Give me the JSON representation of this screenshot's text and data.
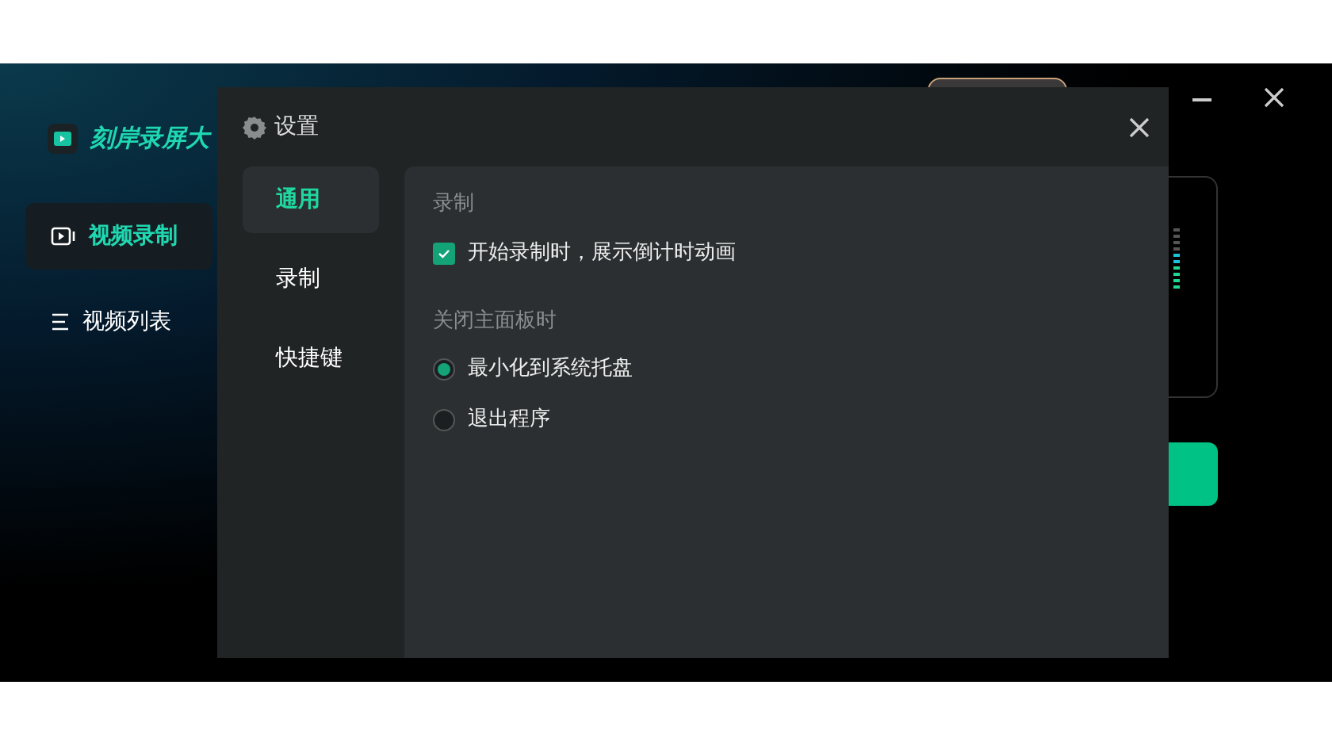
{
  "app": {
    "title": "刻岸录屏大",
    "sidebar": [
      {
        "label": "视频录制",
        "kind": "video",
        "selected": true
      },
      {
        "label": "视频列表",
        "kind": "list",
        "selected": false
      }
    ]
  },
  "dialog": {
    "title": "设置",
    "tabs": [
      {
        "label": "通用",
        "selected": true
      },
      {
        "label": "录制",
        "selected": false
      },
      {
        "label": "快捷键",
        "selected": false
      }
    ],
    "sections": [
      {
        "heading": "录制",
        "options": [
          {
            "kind": "checkbox",
            "label": "开始录制时，展示倒计时动画",
            "checked": true
          }
        ]
      },
      {
        "heading": "关闭主面板时",
        "options": [
          {
            "kind": "radio",
            "label": "最小化到系统托盘",
            "selected": true
          },
          {
            "kind": "radio",
            "label": "退出程序",
            "selected": false
          }
        ]
      }
    ]
  }
}
